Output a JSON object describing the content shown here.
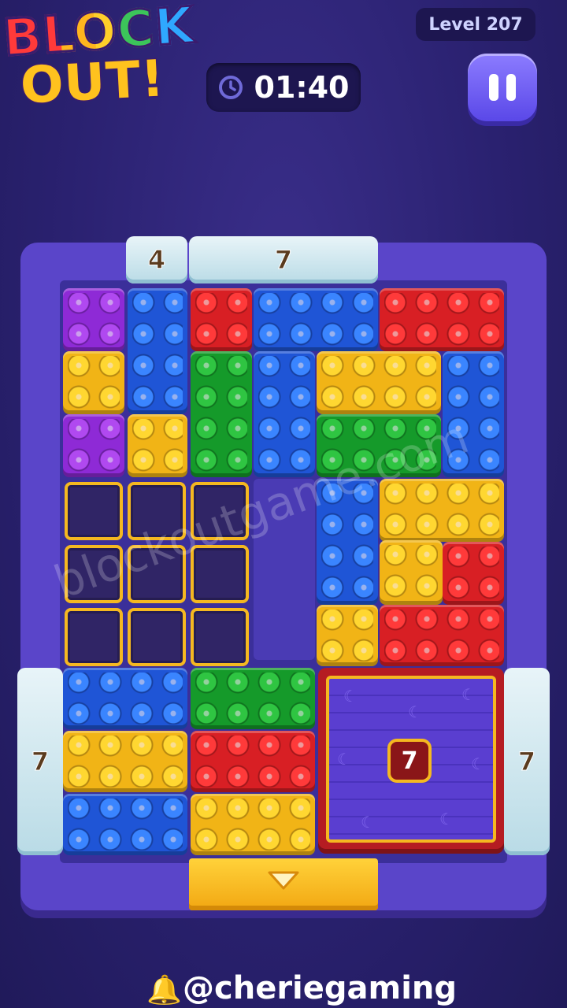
{
  "logo": {
    "line1": "BLOCK",
    "line2": "OUT!"
  },
  "timer": {
    "icon": "clock-icon",
    "value": "01:40"
  },
  "level": {
    "label": "Level 207"
  },
  "pause": {
    "icon": "pause-icon"
  },
  "gates": {
    "top_left": "4",
    "top_right": "7",
    "left": "7",
    "right": "7"
  },
  "box": {
    "count": "7"
  },
  "exit": {
    "icon": "down-arrow-icon"
  },
  "watermark": "blockoutgame.com",
  "footer": {
    "icon": "bell-icon",
    "handle": "@cheriegaming"
  },
  "colors": {
    "red": "#d81f24",
    "blue": "#1f55d6",
    "yellow": "#f1b416",
    "green": "#159a2a",
    "purple": "#8e2ad6",
    "board": "#5a45c9"
  }
}
